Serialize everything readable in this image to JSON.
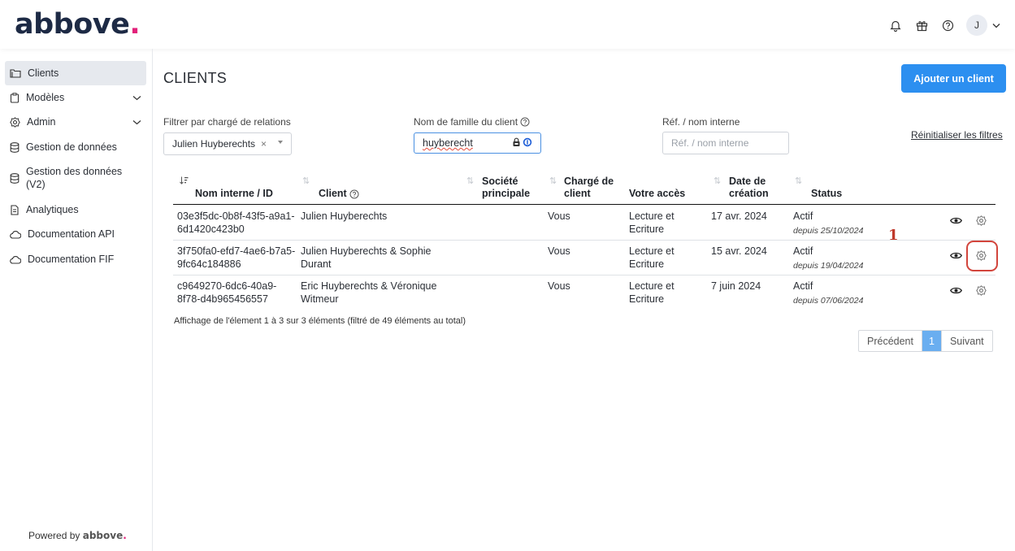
{
  "app": {
    "logo_text": "abbove",
    "logo_dot": ".",
    "avatar_initial": "J"
  },
  "sidebar": {
    "items": [
      {
        "label": "Clients",
        "icon": "folder-icon"
      },
      {
        "label": "Modèles",
        "icon": "clipboard-icon"
      },
      {
        "label": "Admin",
        "icon": "gear-icon"
      },
      {
        "label": "Gestion de données",
        "icon": "database-icon"
      },
      {
        "label": "Gestion des données (V2)",
        "icon": "database-icon"
      },
      {
        "label": "Analytiques",
        "icon": "document-icon"
      },
      {
        "label": "Documentation API",
        "icon": "cloud-icon"
      },
      {
        "label": "Documentation FIF",
        "icon": "cloud-icon"
      }
    ],
    "powered_prefix": "Powered by",
    "powered_brand": "abbove",
    "powered_dot": "."
  },
  "main": {
    "title": "CLIENTS",
    "add_button": "Ajouter un client",
    "filters": {
      "relation_label": "Filtrer par chargé de relations",
      "relation_value": "Julien Huyberechts",
      "relation_clear": "×",
      "family_label": "Nom de famille du client",
      "family_value": "huyberecht",
      "ref_label": "Réf. / nom interne",
      "ref_placeholder": "Réf. / nom interne",
      "reset": "Réinitialiser les filtres"
    },
    "table": {
      "headers": {
        "id_l1": "Nom interne / ID",
        "client": "Client",
        "societe_l1": "Société",
        "societe_l2": "principale",
        "charge_l1": "Chargé de",
        "charge_l2": "client",
        "acces": "Votre accès",
        "date_l1": "Date de",
        "date_l2": "création",
        "status": "Status"
      },
      "rows": [
        {
          "id_l1": "03e3f5dc-0b8f-43f5-a9a1-",
          "id_l2": "6d1420c423b0",
          "client_l1": "Julien Huyberechts",
          "client_l2": "",
          "charge": "Vous",
          "acces_l1": "Lecture et",
          "acces_l2": "Ecriture",
          "date": "17 avr. 2024",
          "status": "Actif",
          "since": "depuis 25/10/2024"
        },
        {
          "id_l1": "3f750fa0-efd7-4ae6-b7a5-",
          "id_l2": "9fc64c184886",
          "client_l1": "Julien Huyberechts & Sophie",
          "client_l2": "Durant",
          "charge": "Vous",
          "acces_l1": "Lecture et",
          "acces_l2": "Ecriture",
          "date": "15 avr. 2024",
          "status": "Actif",
          "since": "depuis 19/04/2024"
        },
        {
          "id_l1": "c9649270-6dc6-40a9-",
          "id_l2": "8f78-d4b965456557",
          "client_l1": "Eric Huyberechts & Véronique",
          "client_l2": "Witmeur",
          "charge": "Vous",
          "acces_l1": "Lecture et",
          "acces_l2": "Ecriture",
          "date": "7 juin 2024",
          "status": "Actif",
          "since": "depuis 07/06/2024"
        }
      ]
    },
    "info": "Affichage de l'élement 1 à 3 sur 3 éléments (filtré de 49 éléments au total)",
    "pager": {
      "prev": "Précédent",
      "current": "1",
      "next": "Suivant"
    }
  },
  "annotation": {
    "number": "1"
  },
  "colors": {
    "accent": "#2c8ff0",
    "brand_dot": "#e2217a",
    "annotation": "#d2453c"
  }
}
